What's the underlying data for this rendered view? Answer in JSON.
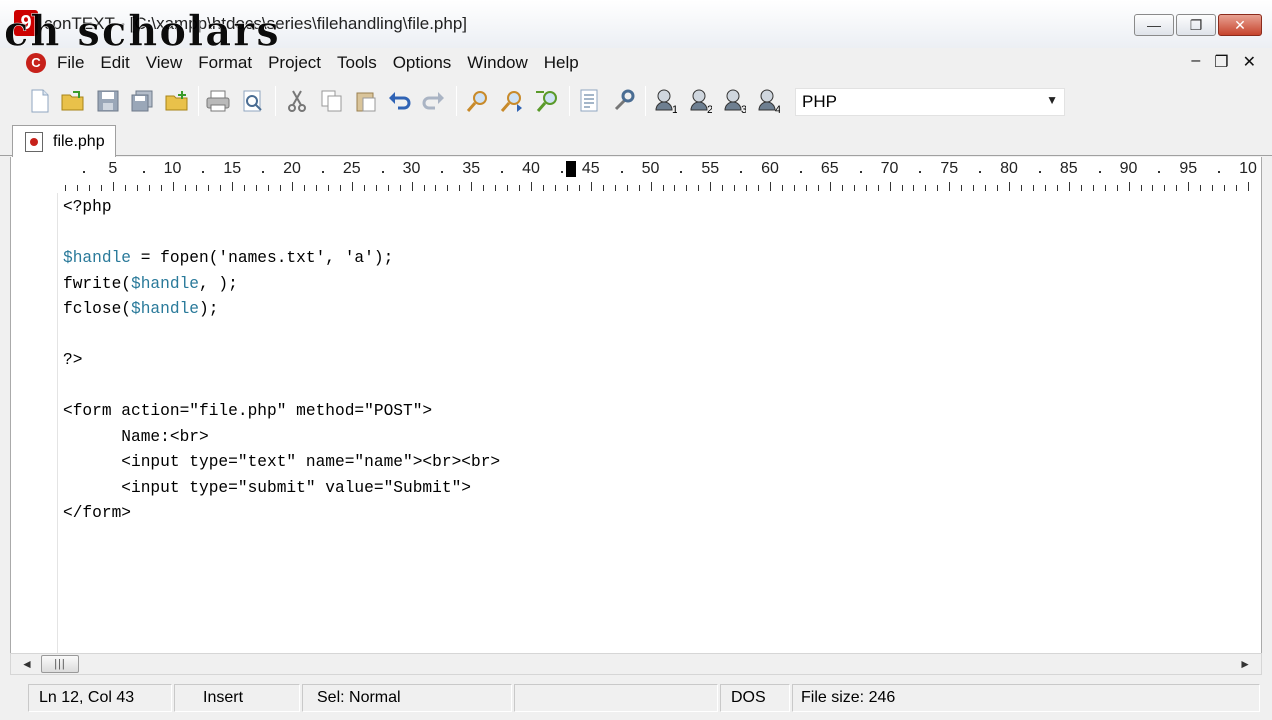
{
  "window": {
    "title": "conTEXT - [C:\\xampp\\htdocs\\series\\filehandling\\file.php]",
    "watermark": "ch scholars",
    "logo_letter": "9",
    "minimize": "—",
    "maximize": "❐",
    "close": "✕"
  },
  "menu": {
    "logo_letter": "C",
    "items": [
      "File",
      "Edit",
      "View",
      "Format",
      "Project",
      "Tools",
      "Options",
      "Window",
      "Help"
    ],
    "mdi_minimize": "–",
    "mdi_restore": "❐",
    "mdi_close": "✕"
  },
  "toolbar": {
    "icons": [
      "new-file-icon",
      "open-file-icon",
      "save-icon",
      "save-all-icon",
      "open-folder-icon",
      "print-icon",
      "print-preview-icon",
      "cut-icon",
      "copy-icon",
      "paste-icon",
      "undo-icon",
      "redo-icon",
      "find-icon",
      "find-next-icon",
      "replace-icon",
      "file-compare-icon",
      "tools-icon",
      "user-command-1-icon",
      "user-command-2-icon",
      "user-command-3-icon",
      "user-command-4-icon"
    ],
    "language": "PHP"
  },
  "tab": {
    "label": "file.php"
  },
  "ruler": {
    "numbers": [
      "5",
      "10",
      "15",
      "20",
      "25",
      "30",
      "35",
      "40",
      "45",
      "50",
      "55",
      "60",
      "65",
      "70",
      "75",
      "80",
      "85",
      "90",
      "95",
      "10"
    ]
  },
  "code": {
    "lines": [
      "<?php",
      "",
      "$handle = fopen('names.txt', 'a');",
      "fwrite($handle, );",
      "fclose($handle);",
      "",
      "?>",
      "",
      "<form action=\"file.php\" method=\"POST\">",
      "      Name:<br>",
      "      <input type=\"text\" name=\"name\"><br><br>",
      "      <input type=\"submit\" value=\"Submit\">",
      "</form>"
    ]
  },
  "scrollbar": {
    "left_arrow": "◄",
    "right_arrow": "►",
    "thumb_grip": "|||"
  },
  "status": {
    "position": "Ln 12, Col 43",
    "mode": "Insert",
    "selection": "Sel: Normal",
    "empty": "",
    "line_ending": "DOS",
    "file_size": "File size: 246"
  },
  "colors": {
    "variable": "#2a7a9a",
    "logo_red": "#c7211a",
    "close_button": "#c6442d"
  }
}
